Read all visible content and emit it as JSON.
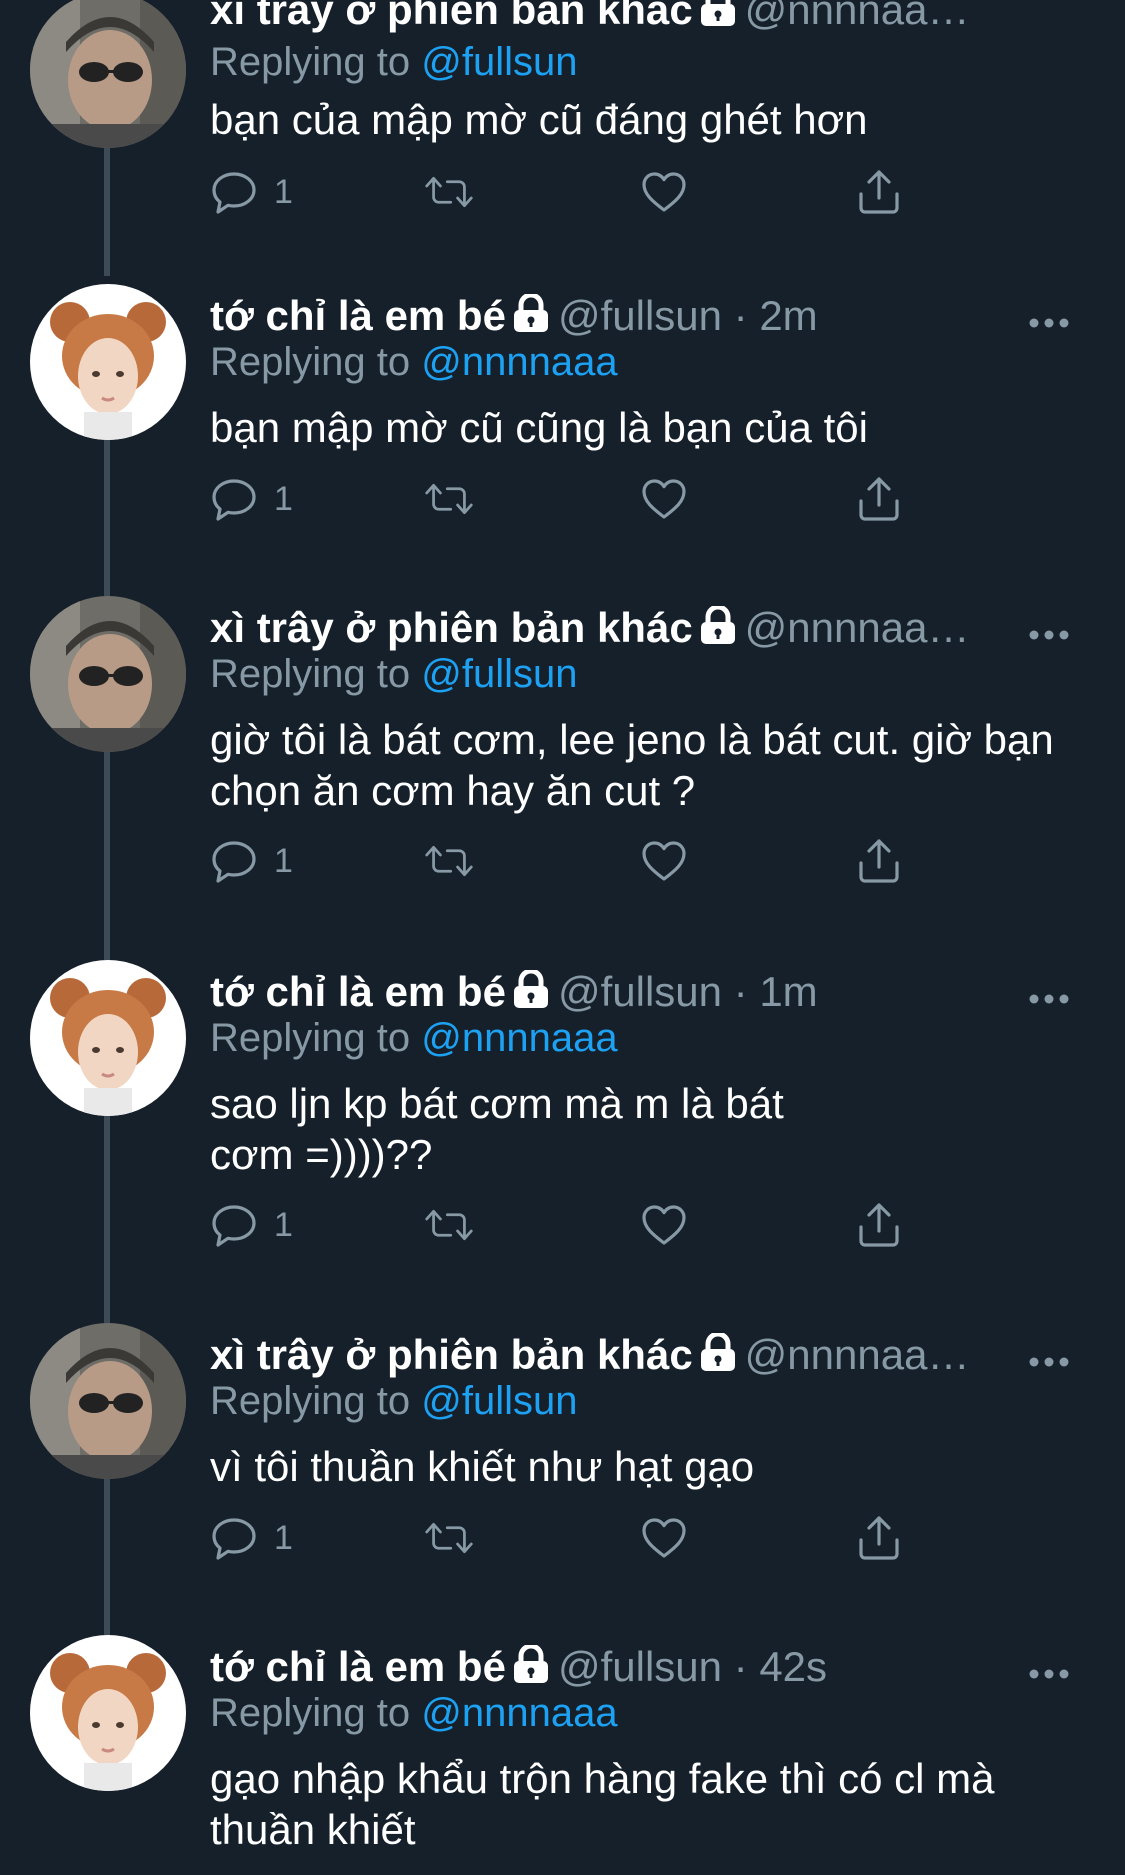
{
  "tweets": [
    {
      "display_name": "xì trây ở phiên bản khác",
      "handle": "@nnnnaa…",
      "meta": "",
      "replying_prefix": "Replying to",
      "replying_to": "@fullsun",
      "text": "bạn của mập mờ cũ đáng ghét hơn",
      "reply_count": "1"
    },
    {
      "display_name": "tớ chỉ là em bé",
      "handle": "@fullsun",
      "meta": "· 2m",
      "replying_prefix": "Replying to",
      "replying_to": "@nnnnaaa",
      "text": "bạn mập mờ cũ cũng là bạn của tôi",
      "reply_count": "1"
    },
    {
      "display_name": "xì trây ở phiên bản khác",
      "handle": "@nnnnaa…",
      "meta": "",
      "replying_prefix": "Replying to",
      "replying_to": "@fullsun",
      "text": "giờ tôi là bát cơm, lee jeno là bát cut. giờ bạn chọn ăn cơm hay ăn cut ?",
      "reply_count": "1"
    },
    {
      "display_name": "tớ chỉ là em bé",
      "handle": "@fullsun",
      "meta": "· 1m",
      "replying_prefix": "Replying to",
      "replying_to": "@nnnnaaa",
      "text": "sao ljn kp bát cơm mà m là bát cơm =))))??",
      "reply_count": "1"
    },
    {
      "display_name": "xì trây ở phiên bản khác",
      "handle": "@nnnnaa…",
      "meta": "",
      "replying_prefix": "Replying to",
      "replying_to": "@fullsun",
      "text": "vì tôi thuần khiết như hạt gạo",
      "reply_count": "1"
    },
    {
      "display_name": "tớ chỉ là em bé",
      "handle": "@fullsun",
      "meta": "· 42s",
      "replying_prefix": "Replying to",
      "replying_to": "@nnnnaaa",
      "text": "gạo nhập khẩu trộn hàng fake thì có cl mà thuần khiết",
      "reply_count": ""
    }
  ],
  "icons": {
    "reply": "reply-icon",
    "retweet": "retweet-icon",
    "like": "heart-icon",
    "share": "share-icon",
    "more": "more-icon",
    "lock": "lock-icon"
  },
  "colors": {
    "background": "#15202b",
    "text": "#ffffff",
    "secondary": "#8899a6",
    "link": "#1da1f2",
    "thread_line": "#3d4b57"
  }
}
